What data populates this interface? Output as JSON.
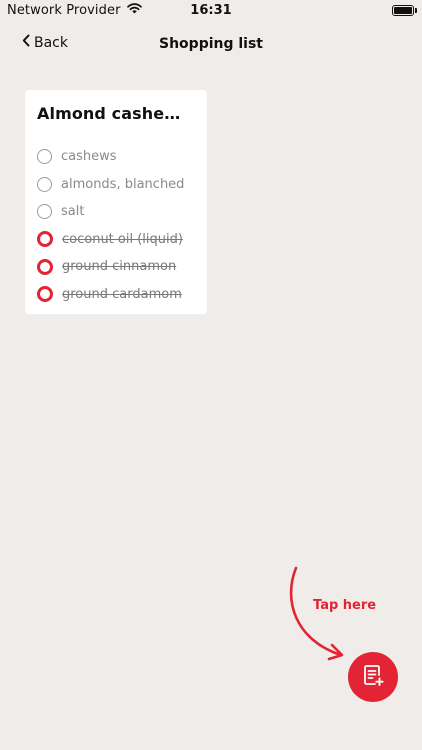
{
  "status_bar": {
    "carrier": "Network Provider",
    "time": "16:31",
    "icons": [
      "wifi-icon",
      "battery-icon"
    ]
  },
  "nav": {
    "back_label": "Back",
    "title": "Shopping list",
    "back_icon": "chevron-left-icon"
  },
  "card": {
    "title": "Almond cashew b...",
    "items": [
      {
        "label": "cashews",
        "checked": false
      },
      {
        "label": "almonds, blanched",
        "checked": false
      },
      {
        "label": "salt",
        "checked": false
      },
      {
        "label": "coconut oil (liquid)",
        "checked": true
      },
      {
        "label": "ground cinnamon",
        "checked": true
      },
      {
        "label": "ground cardamom",
        "checked": true
      }
    ]
  },
  "hint": {
    "text": "Tap here",
    "color": "#e32434"
  },
  "fab": {
    "icon": "list-add-icon",
    "color": "#e32434"
  },
  "colors": {
    "background": "#f0ecea",
    "accent": "#e32434"
  }
}
